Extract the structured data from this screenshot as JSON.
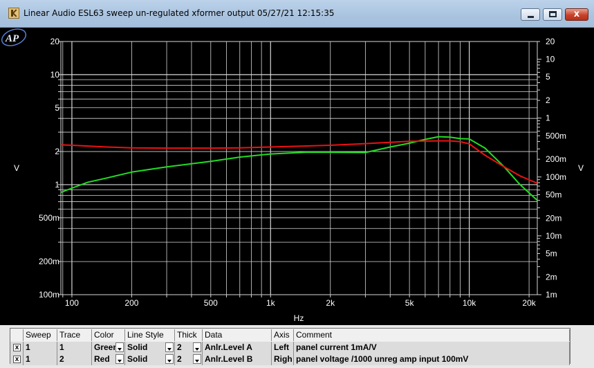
{
  "window": {
    "title": "Linear Audio  ESL63 sweep un-regulated xformer output  05/27/21 12:15:35",
    "minimize_icon": "minimize-icon",
    "maximize_icon": "maximize-icon",
    "close_label": "x"
  },
  "graph": {
    "logo_text": "AP",
    "colors": {
      "background": "#000000",
      "grid": "#d8d8d8",
      "text": "#ffffff"
    }
  },
  "chart_data": {
    "type": "line",
    "xlabel": "Hz",
    "ylabel_left": "V",
    "ylabel_right": "V",
    "x_scale": "log",
    "xlim": [
      88,
      22000
    ],
    "x_tick_labels": [
      {
        "value": 100,
        "label": "100"
      },
      {
        "value": 200,
        "label": "200"
      },
      {
        "value": 500,
        "label": "500"
      },
      {
        "value": 1000,
        "label": "1k"
      },
      {
        "value": 2000,
        "label": "2k"
      },
      {
        "value": 5000,
        "label": "5k"
      },
      {
        "value": 10000,
        "label": "10k"
      },
      {
        "value": 20000,
        "label": "20k"
      }
    ],
    "left_axis": {
      "scale": "log",
      "ylim": [
        0.1,
        20
      ],
      "tick_labels": [
        {
          "value": 20,
          "label": "20"
        },
        {
          "value": 10,
          "label": "10"
        },
        {
          "value": 5,
          "label": "5"
        },
        {
          "value": 2,
          "label": "2"
        },
        {
          "value": 1,
          "label": "1"
        },
        {
          "value": 0.5,
          "label": "500m"
        },
        {
          "value": 0.2,
          "label": "200m"
        },
        {
          "value": 0.1,
          "label": "100m"
        }
      ]
    },
    "right_axis": {
      "scale": "log",
      "ylim": [
        0.001,
        20
      ],
      "tick_labels": [
        {
          "value": 20,
          "label": "20"
        },
        {
          "value": 10,
          "label": "10"
        },
        {
          "value": 5,
          "label": "5"
        },
        {
          "value": 2,
          "label": "2"
        },
        {
          "value": 1,
          "label": "1"
        },
        {
          "value": 0.5,
          "label": "500m"
        },
        {
          "value": 0.2,
          "label": "200m"
        },
        {
          "value": 0.1,
          "label": "100m"
        },
        {
          "value": 0.05,
          "label": "50m"
        },
        {
          "value": 0.02,
          "label": "20m"
        },
        {
          "value": 0.01,
          "label": "10m"
        },
        {
          "value": 0.005,
          "label": "5m"
        },
        {
          "value": 0.002,
          "label": "2m"
        },
        {
          "value": 0.001,
          "label": "1m"
        }
      ]
    },
    "grid": true,
    "series": [
      {
        "color": "#22dd22",
        "axis": "left",
        "x": [
          88,
          100,
          120,
          150,
          200,
          300,
          500,
          700,
          1000,
          1500,
          2000,
          3000,
          4000,
          5000,
          6000,
          7000,
          8000,
          9000,
          10000,
          12000,
          15000,
          18000,
          22000
        ],
        "y": [
          0.85,
          0.93,
          1.05,
          1.15,
          1.3,
          1.45,
          1.63,
          1.78,
          1.9,
          1.97,
          1.97,
          1.96,
          2.2,
          2.38,
          2.58,
          2.73,
          2.7,
          2.62,
          2.6,
          2.15,
          1.45,
          1.0,
          0.72
        ]
      },
      {
        "color": "#ee1111",
        "axis": "left",
        "x": [
          88,
          100,
          150,
          200,
          300,
          500,
          700,
          1000,
          2000,
          3000,
          5000,
          7000,
          8000,
          9000,
          10000,
          12000,
          15000,
          18000,
          22000
        ],
        "y": [
          2.3,
          2.28,
          2.2,
          2.16,
          2.15,
          2.15,
          2.16,
          2.2,
          2.28,
          2.36,
          2.48,
          2.5,
          2.5,
          2.46,
          2.35,
          1.85,
          1.45,
          1.2,
          1.03
        ]
      }
    ]
  },
  "table": {
    "headers": [
      "Sweep",
      "Trace",
      "Color",
      "Line Style",
      "Thick",
      "Data",
      "Axis",
      "Comment"
    ],
    "rows": [
      {
        "checked": "x",
        "sweep": "1",
        "trace": "1",
        "color": "Green",
        "line_style": "Solid",
        "thick": "2",
        "data": "Anlr.Level A",
        "axis": "Left",
        "comment": "panel current 1mA/V"
      },
      {
        "checked": "x",
        "sweep": "1",
        "trace": "2",
        "color": "Red",
        "line_style": "Solid",
        "thick": "2",
        "data": "Anlr.Level B",
        "axis": "Righ",
        "comment": "panel voltage /1000 unreg amp input 100mV"
      }
    ]
  }
}
